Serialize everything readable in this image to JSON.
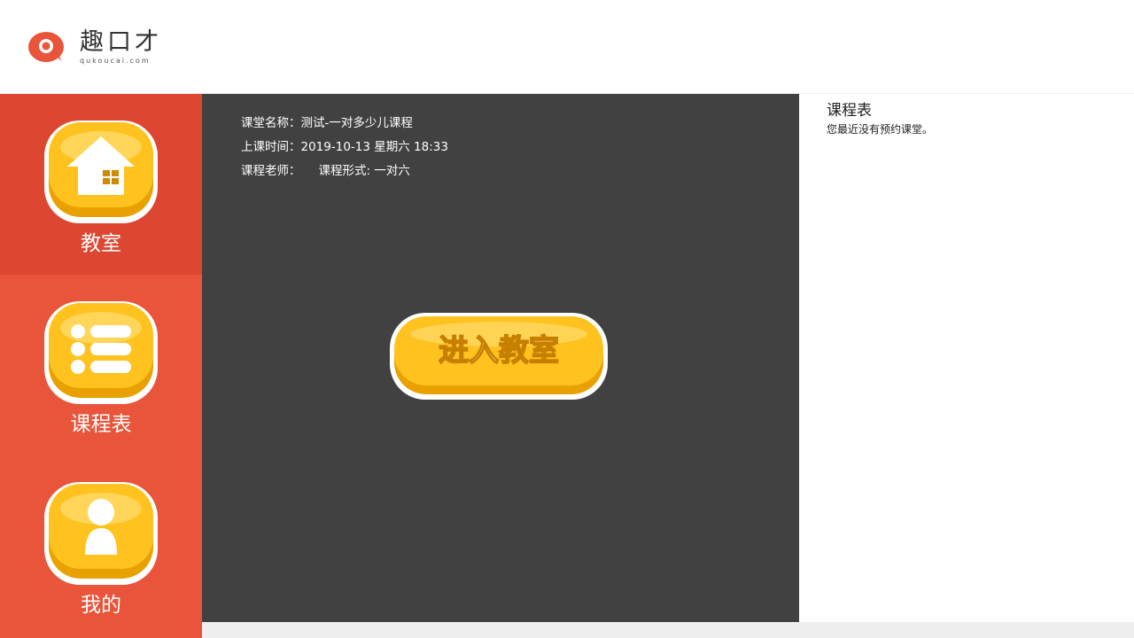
{
  "brand": {
    "name": "趣口才",
    "domain": "qukoucai.com",
    "accent": "#e8553b"
  },
  "sidebar": {
    "items": [
      {
        "label": "教室",
        "icon": "home-icon",
        "active": true
      },
      {
        "label": "课程表",
        "icon": "list-icon",
        "active": false
      },
      {
        "label": "我的",
        "icon": "user-icon",
        "active": false
      }
    ]
  },
  "main": {
    "class_name": "课堂名称：测试-一对多少儿课程",
    "class_time": "上课时间：2019-10-13 星期六 18:33",
    "teacher": "课程老师：",
    "format": "课程形式: 一对六",
    "enter_button": "进入教室"
  },
  "schedule": {
    "title": "课程表",
    "empty_note": "您最近没有预约课堂。"
  }
}
